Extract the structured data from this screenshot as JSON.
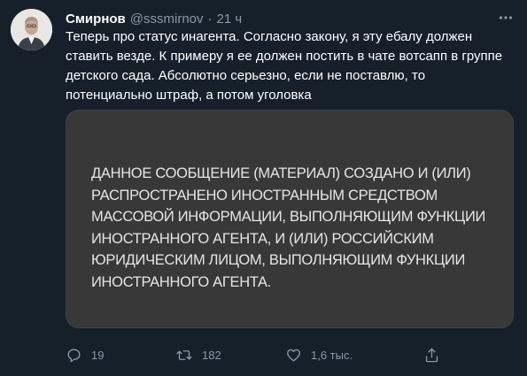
{
  "tweet": {
    "author_name": "Смирнов",
    "author_handle": "@sssmirnov",
    "separator": "·",
    "time": "21 ч",
    "body": "Теперь про статус инагента. Согласно закону, я эту ебалу должен ставить везде. К примеру я ее должен постить в чате вотсапп в группе детского сада. Абсолютно серьезно, если не поставлю, то потенциально штраф, а потом уголовка",
    "media_text": "ДАННОЕ СООБЩЕНИЕ (МАТЕРИАЛ) СОЗДАНО И (ИЛИ) РАСПРОСТРАНЕНО ИНОСТРАННЫМ СРЕДСТВОМ МАССОВОЙ ИНФОРМАЦИИ, ВЫПОЛНЯЮЩИМ ФУНКЦИИ ИНОСТРАННОГО АГЕНТА, И (ИЛИ) РОССИЙСКИМ ЮРИДИЧЕСКИМ ЛИЦОМ, ВЫПОЛНЯЮЩИМ ФУНКЦИИ ИНОСТРАННОГО АГЕНТА.",
    "replies": "19",
    "retweets": "182",
    "likes": "1,6 тыс.",
    "icons": [
      "more-icon",
      "reply-icon",
      "retweet-icon",
      "like-icon",
      "share-icon"
    ]
  },
  "colors": {
    "background": "#15202b",
    "text": "#ffffff",
    "secondary": "#8899a6",
    "media_bg": "#383838"
  }
}
